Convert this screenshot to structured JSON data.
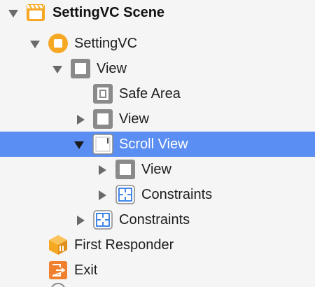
{
  "outline": {
    "scene": {
      "label": "SettingVC Scene",
      "icon": "scene-icon",
      "disclosure": "expanded"
    },
    "view_controller": {
      "label": "SettingVC",
      "icon": "view-controller-icon",
      "disclosure": "expanded"
    },
    "root_view": {
      "label": "View",
      "icon": "view-icon",
      "disclosure": "expanded"
    },
    "safe_area": {
      "label": "Safe Area",
      "icon": "safe-area-icon"
    },
    "child_view": {
      "label": "View",
      "icon": "view-icon",
      "disclosure": "collapsed"
    },
    "scroll_view": {
      "label": "Scroll View",
      "icon": "scroll-view-icon",
      "disclosure": "expanded",
      "selected": true
    },
    "scroll_content_view": {
      "label": "View",
      "icon": "view-icon",
      "disclosure": "collapsed"
    },
    "scroll_constraints": {
      "label": "Constraints",
      "icon": "constraints-icon",
      "disclosure": "collapsed"
    },
    "view_constraints": {
      "label": "Constraints",
      "icon": "constraints-icon",
      "disclosure": "collapsed"
    },
    "first_responder": {
      "label": "First Responder",
      "icon": "first-responder-icon"
    },
    "exit": {
      "label": "Exit",
      "icon": "exit-icon"
    }
  },
  "colors": {
    "background": "#f5f5f5",
    "selection": "#5a8ef2",
    "scene_orange": "#f7a823",
    "constraint_blue": "#2d7ae6",
    "icon_gray": "#8a8a8a",
    "disclosure_gray": "#6a6a6a"
  }
}
